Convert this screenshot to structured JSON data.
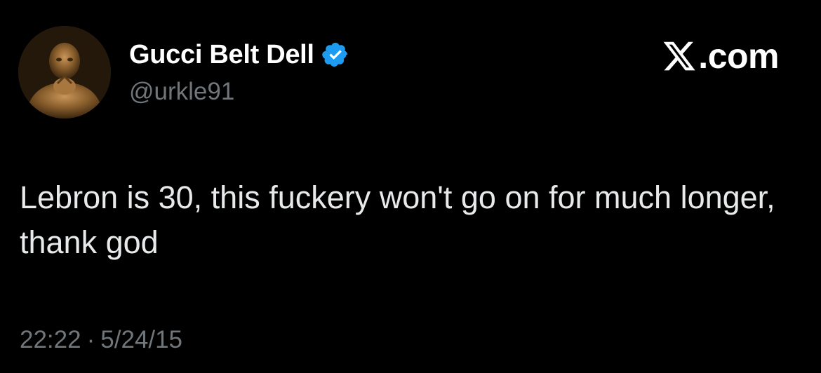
{
  "author": {
    "display_name": "Gucci Belt Dell",
    "handle": "@urkle91",
    "avatar_icon": "bronze-statue-avatar",
    "verified_icon": "verified-badge-icon",
    "verified_color": "#1d9bf0"
  },
  "brand": {
    "logo_icon": "x-logo-icon",
    "suffix": ".com"
  },
  "tweet": {
    "text": "Lebron is 30, this fuckery won't go on for much longer, thank god",
    "time": "22:22",
    "separator": "·",
    "date": "5/24/15"
  },
  "colors": {
    "background": "#000000",
    "primary_text": "#e7e9ea",
    "secondary_text": "#71767b"
  }
}
